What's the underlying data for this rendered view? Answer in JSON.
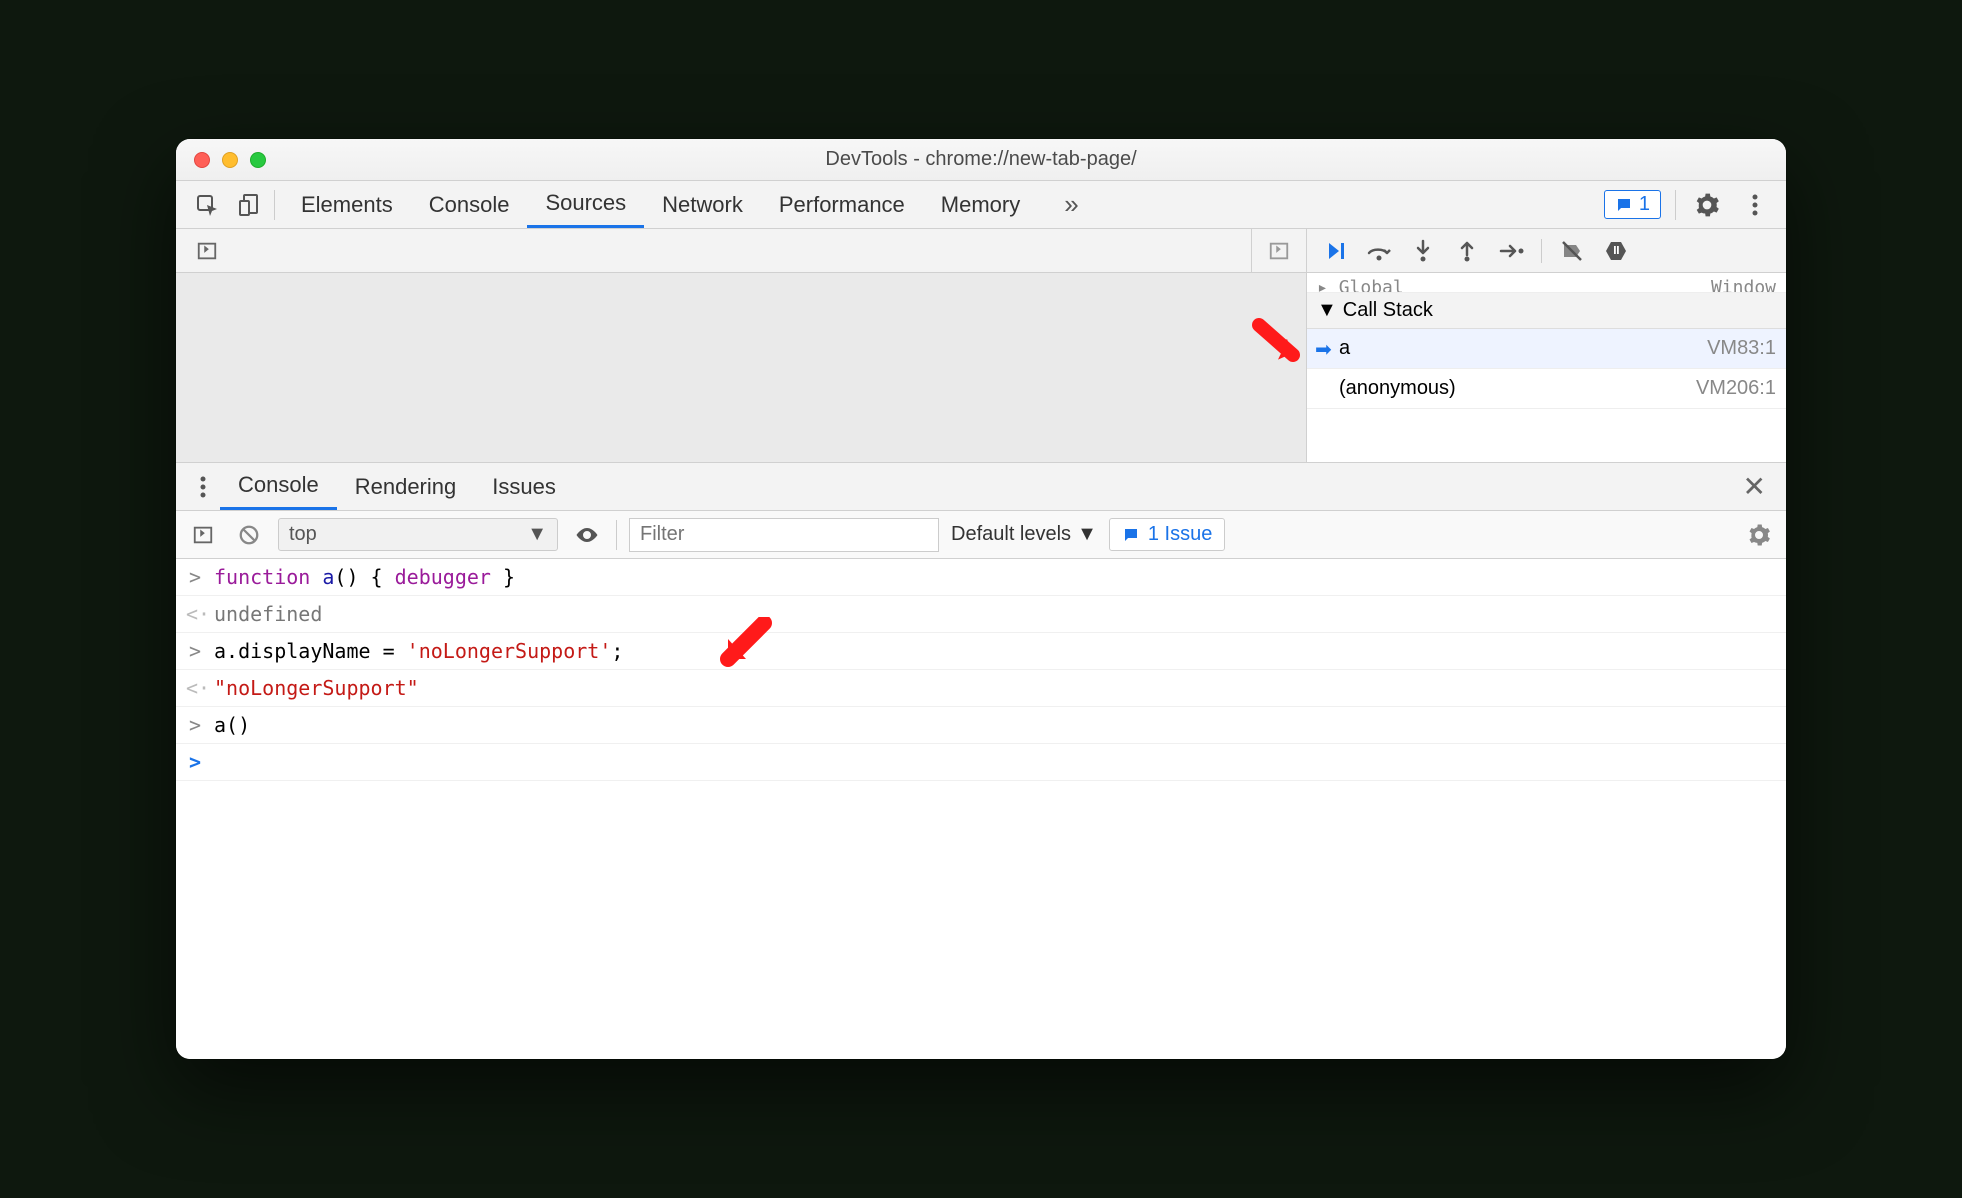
{
  "window": {
    "title": "DevTools - chrome://new-tab-page/"
  },
  "mainTabs": {
    "items": [
      "Elements",
      "Console",
      "Sources",
      "Network",
      "Performance",
      "Memory"
    ],
    "activeIndex": 2,
    "moreGlyph": "»",
    "issuesBadge": "1"
  },
  "debugger": {
    "scope": {
      "left": "Global",
      "right": "Window"
    },
    "callStackLabel": "Call Stack",
    "stack": [
      {
        "name": "a",
        "location": "VM83:1",
        "current": true
      },
      {
        "name": "(anonymous)",
        "location": "VM206:1",
        "current": false
      }
    ]
  },
  "drawer": {
    "tabs": [
      "Console",
      "Rendering",
      "Issues"
    ],
    "activeIndex": 0
  },
  "consoleToolbar": {
    "context": "top",
    "filterPlaceholder": "Filter",
    "levels": "Default levels",
    "issueLink": "1 Issue"
  },
  "consoleLog": [
    {
      "type": "input",
      "tokens": [
        {
          "t": "kw",
          "v": "function"
        },
        {
          "t": "plain",
          "v": " "
        },
        {
          "t": "fn",
          "v": "a"
        },
        {
          "t": "plain",
          "v": "() { "
        },
        {
          "t": "kw",
          "v": "debugger"
        },
        {
          "t": "plain",
          "v": " }"
        }
      ]
    },
    {
      "type": "output",
      "tokens": [
        {
          "t": "undef",
          "v": "undefined"
        }
      ]
    },
    {
      "type": "input",
      "tokens": [
        {
          "t": "plain",
          "v": "a.displayName = "
        },
        {
          "t": "str",
          "v": "'noLongerSupport'"
        },
        {
          "t": "plain",
          "v": ";"
        }
      ]
    },
    {
      "type": "output",
      "tokens": [
        {
          "t": "res-str",
          "v": "\"noLongerSupport\""
        }
      ]
    },
    {
      "type": "input",
      "tokens": [
        {
          "t": "plain",
          "v": "a()"
        }
      ]
    },
    {
      "type": "prompt",
      "tokens": []
    }
  ],
  "colors": {
    "accent": "#1a73e8",
    "annotation": "#ff1a1a"
  }
}
